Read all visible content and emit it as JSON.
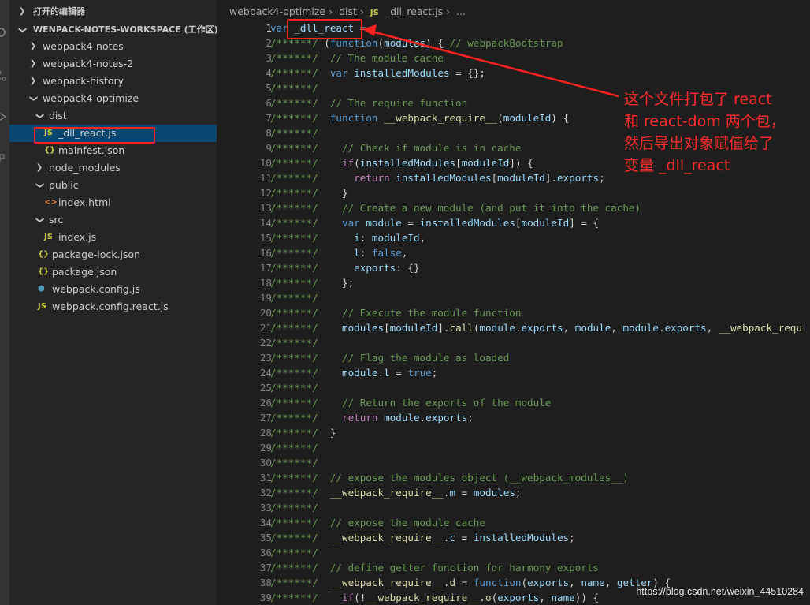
{
  "sidebar": {
    "open_editors": "打开的编辑器",
    "workspace": "WENPACK-NOTES-WORKSPACE (工作区)",
    "items": [
      {
        "label": "webpack4-notes",
        "kind": "folder",
        "depth": 1,
        "open": false
      },
      {
        "label": "webpack4-notes-2",
        "kind": "folder",
        "depth": 1,
        "open": false
      },
      {
        "label": "webpack-history",
        "kind": "folder",
        "depth": 1,
        "open": false
      },
      {
        "label": "webpack4-optimize",
        "kind": "folder",
        "depth": 1,
        "open": true
      },
      {
        "label": "dist",
        "kind": "folder",
        "depth": 2,
        "open": true
      },
      {
        "label": "_dll_react.js",
        "kind": "js",
        "depth": 3,
        "selected": true
      },
      {
        "label": "mainfest.json",
        "kind": "json",
        "depth": 3
      },
      {
        "label": "node_modules",
        "kind": "folder",
        "depth": 2,
        "open": false
      },
      {
        "label": "public",
        "kind": "folder",
        "depth": 2,
        "open": true
      },
      {
        "label": "index.html",
        "kind": "html",
        "depth": 3
      },
      {
        "label": "src",
        "kind": "folder",
        "depth": 2,
        "open": true
      },
      {
        "label": "index.js",
        "kind": "js",
        "depth": 3
      },
      {
        "label": "package-lock.json",
        "kind": "json",
        "depth": 2
      },
      {
        "label": "package.json",
        "kind": "json",
        "depth": 2
      },
      {
        "label": "webpack.config.js",
        "kind": "config",
        "depth": 2
      },
      {
        "label": "webpack.config.react.js",
        "kind": "js",
        "depth": 2
      }
    ]
  },
  "breadcrumb": {
    "parts": [
      "webpack4-optimize",
      "dist",
      "_dll_react.js",
      "..."
    ],
    "file_badge": "JS"
  },
  "icons": {
    "js": "JS",
    "json": "{}",
    "html": "<>",
    "config": "⬢"
  },
  "code_lines": [
    [
      [
        "keyword",
        "var "
      ],
      [
        "var",
        "_dll_react"
      ],
      [
        "text",
        " ="
      ]
    ],
    [
      [
        "comment",
        "/******/ "
      ],
      [
        "text",
        "("
      ],
      [
        "keyword",
        "function"
      ],
      [
        "text",
        "("
      ],
      [
        "var",
        "modules"
      ],
      [
        "text",
        ") { "
      ],
      [
        "comment",
        "// webpackBootstrap"
      ]
    ],
    [
      [
        "comment",
        "/******/  // The module cache"
      ]
    ],
    [
      [
        "comment",
        "/******/  "
      ],
      [
        "keyword",
        "var "
      ],
      [
        "var",
        "installedModules"
      ],
      [
        "text",
        " = {};"
      ]
    ],
    [
      [
        "comment",
        "/******/"
      ]
    ],
    [
      [
        "comment",
        "/******/  // The require function"
      ]
    ],
    [
      [
        "comment",
        "/******/  "
      ],
      [
        "keyword",
        "function "
      ],
      [
        "fn",
        "__webpack_require__"
      ],
      [
        "text",
        "("
      ],
      [
        "var",
        "moduleId"
      ],
      [
        "text",
        ") {"
      ]
    ],
    [
      [
        "comment",
        "/******/"
      ]
    ],
    [
      [
        "comment",
        "/******/    // Check if module is in cache"
      ]
    ],
    [
      [
        "comment",
        "/******/    "
      ],
      [
        "control",
        "if"
      ],
      [
        "text",
        "("
      ],
      [
        "var",
        "installedModules"
      ],
      [
        "text",
        "["
      ],
      [
        "var",
        "moduleId"
      ],
      [
        "text",
        "]) {"
      ]
    ],
    [
      [
        "comment",
        "/******/      "
      ],
      [
        "control",
        "return "
      ],
      [
        "var",
        "installedModules"
      ],
      [
        "text",
        "["
      ],
      [
        "var",
        "moduleId"
      ],
      [
        "text",
        "]."
      ],
      [
        "var",
        "exports"
      ],
      [
        "text",
        ";"
      ]
    ],
    [
      [
        "comment",
        "/******/    "
      ],
      [
        "text",
        "}"
      ]
    ],
    [
      [
        "comment",
        "/******/    // Create a new module (and put it into the cache)"
      ]
    ],
    [
      [
        "comment",
        "/******/    "
      ],
      [
        "keyword",
        "var "
      ],
      [
        "var",
        "module"
      ],
      [
        "text",
        " = "
      ],
      [
        "var",
        "installedModules"
      ],
      [
        "text",
        "["
      ],
      [
        "var",
        "moduleId"
      ],
      [
        "text",
        "] = {"
      ]
    ],
    [
      [
        "comment",
        "/******/      "
      ],
      [
        "var",
        "i"
      ],
      [
        "text",
        ": "
      ],
      [
        "var",
        "moduleId"
      ],
      [
        "text",
        ","
      ]
    ],
    [
      [
        "comment",
        "/******/      "
      ],
      [
        "var",
        "l"
      ],
      [
        "text",
        ": "
      ],
      [
        "keyword",
        "false"
      ],
      [
        "text",
        ","
      ]
    ],
    [
      [
        "comment",
        "/******/      "
      ],
      [
        "var",
        "exports"
      ],
      [
        "text",
        ": {}"
      ]
    ],
    [
      [
        "comment",
        "/******/    "
      ],
      [
        "text",
        "};"
      ]
    ],
    [
      [
        "comment",
        "/******/"
      ]
    ],
    [
      [
        "comment",
        "/******/    // Execute the module function"
      ]
    ],
    [
      [
        "comment",
        "/******/    "
      ],
      [
        "var",
        "modules"
      ],
      [
        "text",
        "["
      ],
      [
        "var",
        "moduleId"
      ],
      [
        "text",
        "]."
      ],
      [
        "fn",
        "call"
      ],
      [
        "text",
        "("
      ],
      [
        "var",
        "module"
      ],
      [
        "text",
        "."
      ],
      [
        "var",
        "exports"
      ],
      [
        "text",
        ", "
      ],
      [
        "var",
        "module"
      ],
      [
        "text",
        ", "
      ],
      [
        "var",
        "module"
      ],
      [
        "text",
        "."
      ],
      [
        "var",
        "exports"
      ],
      [
        "text",
        ", "
      ],
      [
        "fn",
        "__webpack_requ"
      ]
    ],
    [
      [
        "comment",
        "/******/"
      ]
    ],
    [
      [
        "comment",
        "/******/    // Flag the module as loaded"
      ]
    ],
    [
      [
        "comment",
        "/******/    "
      ],
      [
        "var",
        "module"
      ],
      [
        "text",
        "."
      ],
      [
        "var",
        "l"
      ],
      [
        "text",
        " = "
      ],
      [
        "keyword",
        "true"
      ],
      [
        "text",
        ";"
      ]
    ],
    [
      [
        "comment",
        "/******/"
      ]
    ],
    [
      [
        "comment",
        "/******/    // Return the exports of the module"
      ]
    ],
    [
      [
        "comment",
        "/******/    "
      ],
      [
        "control",
        "return "
      ],
      [
        "var",
        "module"
      ],
      [
        "text",
        "."
      ],
      [
        "var",
        "exports"
      ],
      [
        "text",
        ";"
      ]
    ],
    [
      [
        "comment",
        "/******/  "
      ],
      [
        "text",
        "}"
      ]
    ],
    [
      [
        "comment",
        "/******/"
      ]
    ],
    [
      [
        "comment",
        "/******/"
      ]
    ],
    [
      [
        "comment",
        "/******/  // expose the modules object (__webpack_modules__)"
      ]
    ],
    [
      [
        "comment",
        "/******/  "
      ],
      [
        "fn",
        "__webpack_require__"
      ],
      [
        "text",
        "."
      ],
      [
        "var",
        "m"
      ],
      [
        "text",
        " = "
      ],
      [
        "var",
        "modules"
      ],
      [
        "text",
        ";"
      ]
    ],
    [
      [
        "comment",
        "/******/"
      ]
    ],
    [
      [
        "comment",
        "/******/  // expose the module cache"
      ]
    ],
    [
      [
        "comment",
        "/******/  "
      ],
      [
        "fn",
        "__webpack_require__"
      ],
      [
        "text",
        "."
      ],
      [
        "var",
        "c"
      ],
      [
        "text",
        " = "
      ],
      [
        "var",
        "installedModules"
      ],
      [
        "text",
        ";"
      ]
    ],
    [
      [
        "comment",
        "/******/"
      ]
    ],
    [
      [
        "comment",
        "/******/  // define getter function for harmony exports"
      ]
    ],
    [
      [
        "comment",
        "/******/  "
      ],
      [
        "fn",
        "__webpack_require__"
      ],
      [
        "text",
        "."
      ],
      [
        "fn",
        "d"
      ],
      [
        "text",
        " = "
      ],
      [
        "keyword",
        "function"
      ],
      [
        "text",
        "("
      ],
      [
        "var",
        "exports"
      ],
      [
        "text",
        ", "
      ],
      [
        "var",
        "name"
      ],
      [
        "text",
        ", "
      ],
      [
        "var",
        "getter"
      ],
      [
        "text",
        ") {"
      ]
    ],
    [
      [
        "comment",
        "/******/    "
      ],
      [
        "control",
        "if"
      ],
      [
        "text",
        "(!"
      ],
      [
        "fn",
        "__webpack_require__"
      ],
      [
        "text",
        "."
      ],
      [
        "fn",
        "o"
      ],
      [
        "text",
        "("
      ],
      [
        "var",
        "exports"
      ],
      [
        "text",
        ", "
      ],
      [
        "var",
        "name"
      ],
      [
        "text",
        ")) {"
      ]
    ]
  ],
  "current_line": 1,
  "annotation": {
    "lines": [
      "这个文件打包了 react",
      "和 react-dom 两个包，",
      "然后导出对象赋值给了",
      "变量 _dll_react"
    ]
  },
  "watermark": "https://blog.csdn.net/weixin_44510284",
  "colors": {
    "annotation": "#ff2a2a",
    "selection": "#094771"
  }
}
